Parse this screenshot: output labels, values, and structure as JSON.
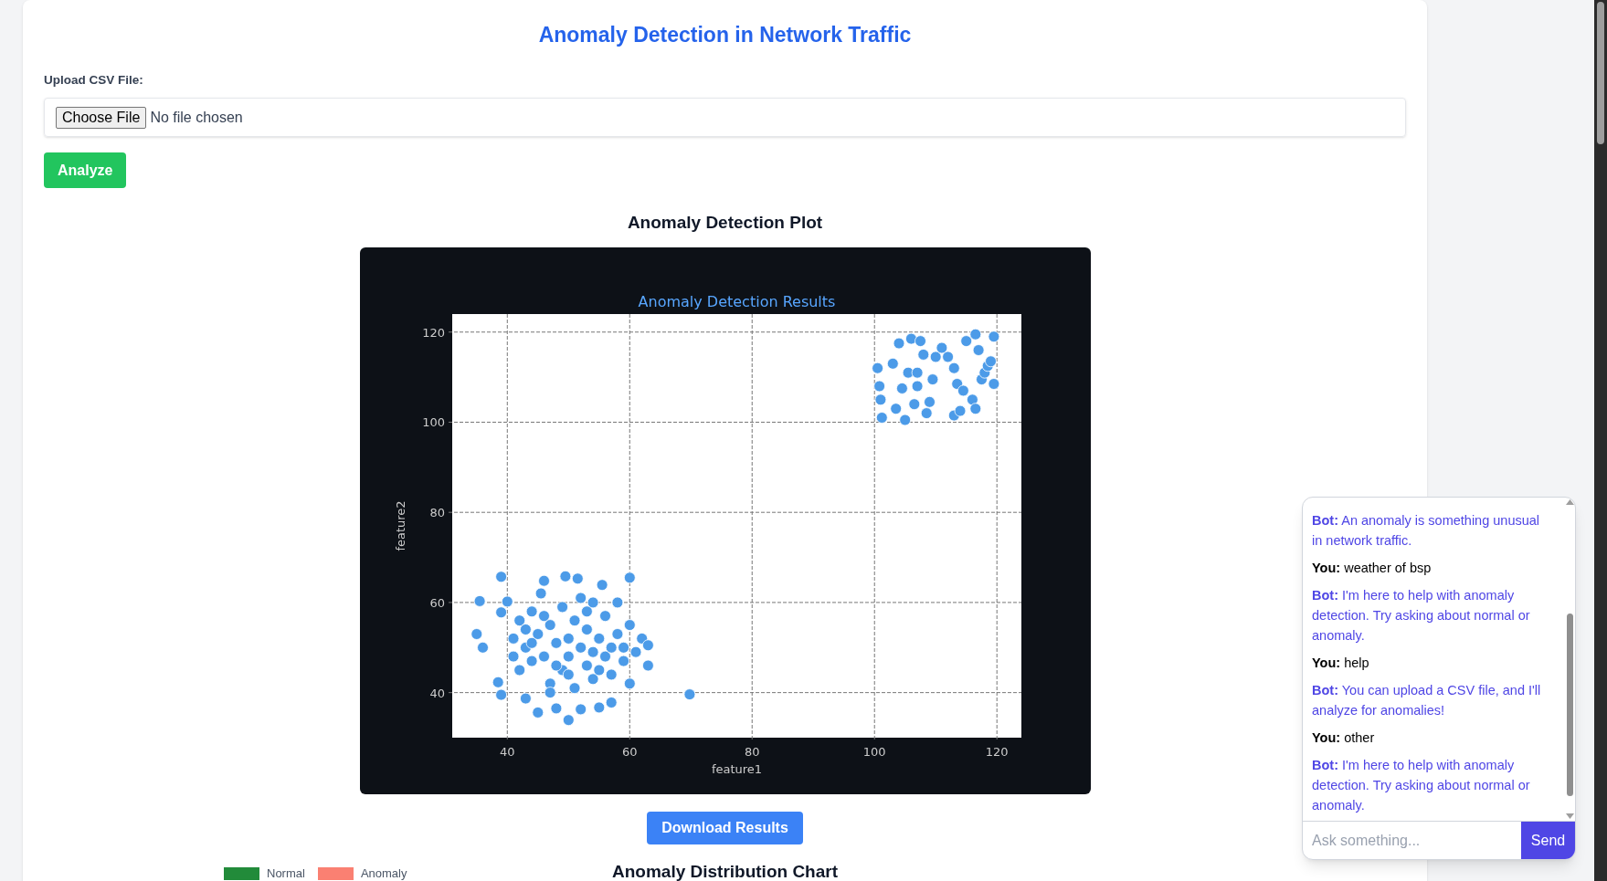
{
  "title": "Anomaly Detection in Network Traffic",
  "upload": {
    "label": "Upload CSV File:",
    "button": "Choose File",
    "status": "No file chosen"
  },
  "analyze_button": "Analyze",
  "plot": {
    "heading": "Anomaly Detection Plot",
    "chart_data": {
      "type": "scatter",
      "title": "Anomaly Detection Results",
      "xlabel": "feature1",
      "ylabel": "feature2",
      "xlim": [
        31,
        124
      ],
      "ylim": [
        30,
        124
      ],
      "xticks": [
        40,
        60,
        80,
        100,
        120
      ],
      "yticks": [
        40,
        60,
        80,
        100,
        120
      ],
      "x": [
        35,
        35.5,
        36,
        38.5,
        39,
        39,
        39,
        40,
        41,
        42,
        42,
        43,
        43,
        44,
        44,
        45,
        45,
        45.5,
        46,
        46,
        47,
        47,
        48,
        48,
        49,
        49,
        49.5,
        50,
        50,
        50,
        51,
        51,
        51.5,
        52,
        52,
        53,
        53,
        54,
        54,
        55,
        55,
        55.5,
        56,
        56,
        57,
        57,
        58,
        58,
        59,
        59,
        60,
        60,
        60,
        61,
        62,
        63,
        63,
        69.8,
        44,
        46,
        48,
        53,
        55,
        57,
        41,
        43,
        50,
        52,
        47,
        54,
        100.5,
        100.8,
        101,
        101.2,
        103,
        103.5,
        104,
        104.5,
        105,
        105.5,
        106,
        106.5,
        107,
        107,
        107.5,
        108,
        108.5,
        109,
        109.5,
        110,
        111,
        112,
        113,
        113,
        113.5,
        114,
        114.5,
        115,
        116,
        116.5,
        116.5,
        117,
        117.5,
        118,
        118.5,
        119,
        119.5,
        119.5
      ],
      "grid": true,
      "series": [
        {
          "color": "#4c9be8",
          "values": [
            53,
            60.3,
            50,
            42.3,
            39.5,
            57.8,
            65.7,
            60.2,
            52,
            56,
            45,
            38.7,
            50,
            58,
            47,
            35.6,
            53,
            62,
            48,
            64.8,
            55,
            42,
            51,
            36.5,
            59,
            45,
            65.8,
            33.9,
            52,
            48,
            56,
            41,
            65.3,
            50,
            36.3,
            54,
            46,
            60,
            43,
            52,
            36.7,
            63.9,
            48,
            57,
            44,
            37.8,
            53,
            60,
            47,
            50,
            55,
            42,
            65.5,
            49,
            52,
            46,
            50.5,
            39.6,
            51,
            57,
            46,
            58,
            45,
            50,
            48,
            54,
            44,
            61,
            40,
            49,
            112,
            108,
            105,
            101,
            113,
            103,
            117.5,
            107.5,
            100.5,
            111,
            118.5,
            104,
            108,
            111,
            118,
            115,
            102,
            104.5,
            109.5,
            114.5,
            116.5,
            114.5,
            101.5,
            112,
            108.5,
            102.5,
            107,
            118,
            105,
            119.5,
            103,
            116,
            109.5,
            111,
            112.5,
            113.5,
            119,
            108.5
          ]
        }
      ]
    }
  },
  "download_button": "Download Results",
  "distribution": {
    "heading": "Anomaly Distribution Chart",
    "legend": [
      {
        "label": "Normal",
        "color": "#228b3a"
      },
      {
        "label": "Anomaly",
        "color": "#fa8072"
      }
    ]
  },
  "chat": {
    "messages": [
      {
        "kind": "bot",
        "text": "**Bot:** An anomaly is something unusual in network traffic."
      },
      {
        "kind": "user",
        "text": "**You:** weather of bsp"
      },
      {
        "kind": "bot",
        "text": "**Bot:** I'm here to help with anomaly detection. Try asking about normal or anomaly."
      },
      {
        "kind": "user",
        "text": "**You:** help"
      },
      {
        "kind": "bot",
        "text": "**Bot:** You can upload a CSV file, and I'll analyze for anomalies!"
      },
      {
        "kind": "user",
        "text": "**You:** other"
      },
      {
        "kind": "bot",
        "text": "**Bot:** I'm here to help with anomaly detection. Try asking about normal or anomaly."
      }
    ],
    "placeholder": "Ask something...",
    "send_button": "Send"
  }
}
